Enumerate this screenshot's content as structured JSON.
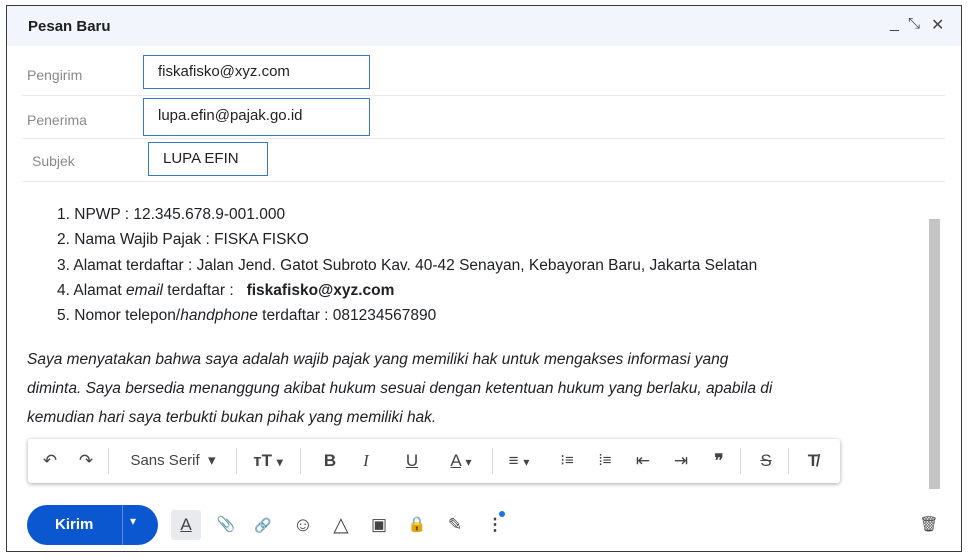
{
  "window": {
    "title": "Pesan Baru",
    "minimize_icon": "_",
    "expand_icon": "⤡",
    "close_icon": "✕"
  },
  "fields": {
    "sender_label": "Pengirim",
    "sender_value": "fiskafisko@xyz.com",
    "recipient_label": "Penerima",
    "recipient_value": "lupa.efin@pajak.go.id",
    "subject_label": "Subjek",
    "subject_value": "LUPA EFIN"
  },
  "body": {
    "list": [
      {
        "num": "1.",
        "text": "NPWP : 12.345.678.9-001.000"
      },
      {
        "num": "2.",
        "text": "Nama Wajib Pajak : FISKA FISKO"
      },
      {
        "num": "3.",
        "text": "Alamat terdaftar : Jalan Jend. Gatot Subroto Kav. 40-42 Senayan, Kebayoran Baru, Jakarta Selatan"
      },
      {
        "num": "4.",
        "text_a": "Alamat ",
        "text_em": "email",
        "text_b": " terdaftar :",
        "text_bold": "fiskafisko@xyz.com"
      },
      {
        "num": "5.",
        "text_a": "Nomor telepon/",
        "text_em": "handphone",
        "text_b": " terdaftar : 081234567890"
      }
    ],
    "paragraph_1": "Saya menyatakan bahwa saya adalah wajib pajak yang memiliki hak untuk mengakses informasi yang",
    "paragraph_2": "diminta. Saya bersedia menanggung akibat hukum sesuai dengan ketentuan hukum yang berlaku, apabila di",
    "paragraph_3": "kemudian hari saya terbukti bukan pihak yang memiliki hak."
  },
  "formatting": {
    "undo_icon": "↶",
    "redo_icon": "↷",
    "font_name": "Sans Serif",
    "font_size_icon": "тT",
    "bold": "B",
    "italic": "I",
    "underline": "U",
    "text_color": "A",
    "align_icon": "≡",
    "numbered_list_icon": "⁝≡",
    "bullet_list_icon": "⁞≡",
    "indent_less_icon": "⇤",
    "indent_more_icon": "⇥",
    "quote_icon": "❞",
    "strikethrough": "S",
    "clear_format_icon": "T̸",
    "dropdown_caret": "▾"
  },
  "bottom": {
    "send_label": "Kirim",
    "send_options_caret": "▾",
    "format_toggle_icon": "A",
    "attach_icon": "📎",
    "link_icon": "🔗",
    "emoji_icon": "☺",
    "drive_icon": "△",
    "photo_icon": "▣",
    "confidential_icon": "🔒",
    "signature_icon": "✎",
    "more_icon": "⋮",
    "delete_icon": "🗑"
  },
  "colors": {
    "accent": "#0b57d0",
    "field_border": "#3c78c8",
    "title_bar": "#f2f6fc",
    "notification_dot": "#1a73e8"
  }
}
